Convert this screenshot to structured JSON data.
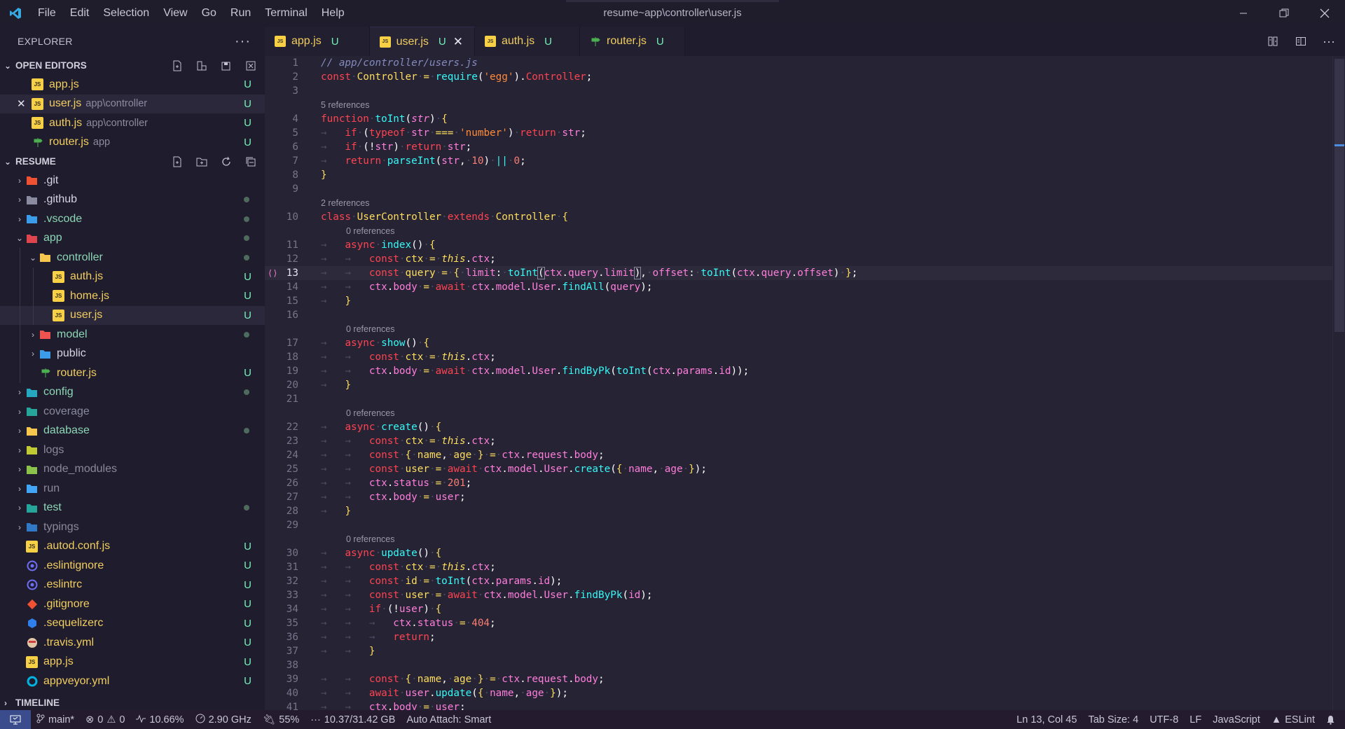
{
  "window": {
    "title": "resume~app\\controller\\user.js",
    "menu": [
      "File",
      "Edit",
      "Selection",
      "View",
      "Go",
      "Run",
      "Terminal",
      "Help"
    ]
  },
  "explorer": {
    "title": "EXPLORER",
    "open_editors_title": "OPEN EDITORS",
    "open_editors": [
      {
        "name": "app.js",
        "desc": "",
        "status": "U",
        "icon": "js",
        "active": false
      },
      {
        "name": "user.js",
        "desc": "app\\controller",
        "status": "U",
        "icon": "js",
        "active": true
      },
      {
        "name": "auth.js",
        "desc": "app\\controller",
        "status": "U",
        "icon": "js",
        "active": false
      },
      {
        "name": "router.js",
        "desc": "app",
        "status": "U",
        "icon": "router",
        "active": false
      }
    ],
    "project_title": "RESUME",
    "tree": [
      {
        "name": ".git",
        "depth": 0,
        "twisty": "›",
        "icon": "git-folder",
        "status": "",
        "color": "plain"
      },
      {
        "name": ".github",
        "depth": 0,
        "twisty": "›",
        "icon": "github-folder",
        "status": "dot",
        "color": "plain"
      },
      {
        "name": ".vscode",
        "depth": 0,
        "twisty": "›",
        "icon": "vscode-folder",
        "status": "dot",
        "color": "mod"
      },
      {
        "name": "app",
        "depth": 0,
        "twisty": "⌄",
        "icon": "app-folder",
        "status": "dot",
        "color": "mod"
      },
      {
        "name": "controller",
        "depth": 1,
        "twisty": "⌄",
        "icon": "controller-folder",
        "status": "dot",
        "color": "mod"
      },
      {
        "name": "auth.js",
        "depth": 2,
        "twisty": "",
        "icon": "js",
        "status": "U",
        "color": "untracked"
      },
      {
        "name": "home.js",
        "depth": 2,
        "twisty": "",
        "icon": "js",
        "status": "U",
        "color": "untracked"
      },
      {
        "name": "user.js",
        "depth": 2,
        "twisty": "",
        "icon": "js",
        "status": "U",
        "color": "untracked",
        "active": true
      },
      {
        "name": "model",
        "depth": 1,
        "twisty": "›",
        "icon": "model-folder",
        "status": "dot",
        "color": "mod"
      },
      {
        "name": "public",
        "depth": 1,
        "twisty": "›",
        "icon": "public-folder",
        "status": "",
        "color": "plain"
      },
      {
        "name": "router.js",
        "depth": 1,
        "twisty": "",
        "icon": "router",
        "status": "U",
        "color": "untracked"
      },
      {
        "name": "config",
        "depth": 0,
        "twisty": "›",
        "icon": "config-folder",
        "status": "dot",
        "color": "mod"
      },
      {
        "name": "coverage",
        "depth": 0,
        "twisty": "›",
        "icon": "coverage-folder",
        "status": "",
        "color": "dim"
      },
      {
        "name": "database",
        "depth": 0,
        "twisty": "›",
        "icon": "database-folder",
        "status": "dot",
        "color": "mod"
      },
      {
        "name": "logs",
        "depth": 0,
        "twisty": "›",
        "icon": "logs-folder",
        "status": "",
        "color": "dim"
      },
      {
        "name": "node_modules",
        "depth": 0,
        "twisty": "›",
        "icon": "node-folder",
        "status": "",
        "color": "dim"
      },
      {
        "name": "run",
        "depth": 0,
        "twisty": "›",
        "icon": "run-folder",
        "status": "",
        "color": "dim"
      },
      {
        "name": "test",
        "depth": 0,
        "twisty": "›",
        "icon": "test-folder",
        "status": "dot",
        "color": "mod"
      },
      {
        "name": "typings",
        "depth": 0,
        "twisty": "›",
        "icon": "typings-folder",
        "status": "",
        "color": "dim"
      },
      {
        "name": ".autod.conf.js",
        "depth": 0,
        "twisty": "",
        "icon": "js",
        "status": "U",
        "color": "untracked"
      },
      {
        "name": ".eslintignore",
        "depth": 0,
        "twisty": "",
        "icon": "eslint",
        "status": "U",
        "color": "untracked"
      },
      {
        "name": ".eslintrc",
        "depth": 0,
        "twisty": "",
        "icon": "eslint",
        "status": "U",
        "color": "untracked"
      },
      {
        "name": ".gitignore",
        "depth": 0,
        "twisty": "",
        "icon": "gitfile",
        "status": "U",
        "color": "untracked"
      },
      {
        "name": ".sequelizerc",
        "depth": 0,
        "twisty": "",
        "icon": "sequelize",
        "status": "U",
        "color": "untracked"
      },
      {
        "name": ".travis.yml",
        "depth": 0,
        "twisty": "",
        "icon": "travis",
        "status": "U",
        "color": "untracked"
      },
      {
        "name": "app.js",
        "depth": 0,
        "twisty": "",
        "icon": "js",
        "status": "U",
        "color": "untracked"
      },
      {
        "name": "appveyor.yml",
        "depth": 0,
        "twisty": "",
        "icon": "appveyor",
        "status": "U",
        "color": "untracked"
      }
    ],
    "timeline_title": "TIMELINE"
  },
  "tabs": [
    {
      "label": "app.js",
      "status": "U",
      "icon": "js",
      "active": false
    },
    {
      "label": "user.js",
      "status": "U",
      "icon": "js",
      "active": true
    },
    {
      "label": "auth.js",
      "status": "U",
      "icon": "js",
      "active": false
    },
    {
      "label": "router.js",
      "status": "U",
      "icon": "router",
      "active": false
    }
  ],
  "editor": {
    "current_line": 13,
    "lines": [
      {
        "n": "1",
        "html": "<span class='cm'>// app/controller/users.js</span>"
      },
      {
        "n": "2",
        "html": "<span class='kw'>const</span><span class='ws'>·</span><span class='k'>Controller</span><span class='ws'>·</span><span class='op'>=</span><span class='ws'>·</span><span class='fn'>require</span><span class='pl'>(</span><span class='st'>'egg'</span><span class='pl'>).</span><span class='kw'>Controller</span><span class='pl'>;</span>"
      },
      {
        "n": "3",
        "html": ""
      },
      {
        "lens": "5 references",
        "indent": 0
      },
      {
        "n": "4",
        "html": "<span class='kw'>function</span><span class='ws'>·</span><span class='fn'>toInt</span><span class='pl'>(</span><span class='va' style='font-style:italic'>str</span><span class='pl'>)</span><span class='ws'>·</span><span class='op'>{</span>"
      },
      {
        "n": "5",
        "html": "<span class='ws'>→   </span><span class='kw'>if</span><span class='ws'>·</span><span class='pl'>(</span><span class='kw'>typeof</span><span class='ws'>·</span><span class='va'>str</span><span class='ws'>·</span><span class='op'>===</span><span class='ws'>·</span><span class='st'>'number'</span><span class='pl'>)</span><span class='ws'>·</span><span class='kw'>return</span><span class='ws'>·</span><span class='va'>str</span><span class='pl'>;</span>"
      },
      {
        "n": "6",
        "html": "<span class='ws'>→   </span><span class='kw'>if</span><span class='ws'>·</span><span class='pl'>(!</span><span class='va'>str</span><span class='pl'>)</span><span class='ws'>·</span><span class='kw'>return</span><span class='ws'>·</span><span class='va'>str</span><span class='pl'>;</span>"
      },
      {
        "n": "7",
        "html": "<span class='ws'>→   </span><span class='kw'>return</span><span class='ws'>·</span><span class='fn'>parseInt</span><span class='pl'>(</span><span class='va'>str</span><span class='pl'>,</span><span class='ws'>·</span><span class='nm'>10</span><span class='pl'>)</span><span class='ws'>·</span><span class='fn'>||</span><span class='ws'>·</span><span class='nm'>0</span><span class='pl'>;</span>"
      },
      {
        "n": "8",
        "html": "<span class='op'>}</span>"
      },
      {
        "n": "9",
        "html": ""
      },
      {
        "lens": "2 references",
        "indent": 0
      },
      {
        "n": "10",
        "html": "<span class='kw'>class</span><span class='ws'>·</span><span class='k'>UserController</span><span class='ws'>·</span><span class='kw'>extends</span><span class='ws'>·</span><span class='k'>Controller</span><span class='ws'>·</span><span class='op'>{</span>"
      },
      {
        "lens": "0 references",
        "indent": 1
      },
      {
        "n": "11",
        "html": "<span class='ws'>→   </span><span class='kw'>async</span><span class='ws'>·</span><span class='fn'>index</span><span class='pl'>()</span><span class='ws'>·</span><span class='op'>{</span>"
      },
      {
        "n": "12",
        "html": "<span class='ws'>→   →   </span><span class='kw'>const</span><span class='ws'>·</span><span class='k'>ctx</span><span class='ws'>·</span><span class='op'>=</span><span class='ws'>·</span><span class='th'>this</span><span class='pl'>.</span><span class='va'>ctx</span><span class='pl'>;</span>"
      },
      {
        "n": "13",
        "cur": true,
        "html": "<span class='ws'>→   →   </span><span class='kw'>const</span><span class='ws'>·</span><span class='k'>query</span><span class='ws'>·</span><span class='op'>=</span><span class='ws'>·</span><span class='op'>{</span><span class='ws'>·</span><span class='va'>limit</span><span class='pl'>:</span><span class='ws'>·</span><span class='fn'>toInt</span><span class='pl' style='outline:1px solid #8a86a0'>(</span><span class='va'>ctx</span><span class='pl'>.</span><span class='va'>query</span><span class='pl'>.</span><span class='va'>limit</span><span class='pl' style='outline:1px solid #8a86a0'>)</span><span class='pl'>,</span><span class='ws'>·</span><span class='va'>offset</span><span class='pl'>:</span><span class='ws'>·</span><span class='fn'>toInt</span><span class='pl'>(</span><span class='va'>ctx</span><span class='pl'>.</span><span class='va'>query</span><span class='pl'>.</span><span class='va'>offset</span><span class='pl'>)</span><span class='ws'>·</span><span class='op'>}</span><span class='pl'>;</span>"
      },
      {
        "n": "14",
        "html": "<span class='ws'>→   →   </span><span class='va'>ctx</span><span class='pl'>.</span><span class='va'>body</span><span class='ws'>·</span><span class='op'>=</span><span class='ws'>·</span><span class='kw'>await</span><span class='ws'>·</span><span class='va'>ctx</span><span class='pl'>.</span><span class='va'>model</span><span class='pl'>.</span><span class='va'>User</span><span class='pl'>.</span><span class='fn'>findAll</span><span class='pl'>(</span><span class='va'>query</span><span class='pl'>);</span>"
      },
      {
        "n": "15",
        "html": "<span class='ws'>→   </span><span class='op'>}</span>"
      },
      {
        "n": "16",
        "html": ""
      },
      {
        "lens": "0 references",
        "indent": 1
      },
      {
        "n": "17",
        "html": "<span class='ws'>→   </span><span class='kw'>async</span><span class='ws'>·</span><span class='fn'>show</span><span class='pl'>()</span><span class='ws'>·</span><span class='op'>{</span>"
      },
      {
        "n": "18",
        "html": "<span class='ws'>→   →   </span><span class='kw'>const</span><span class='ws'>·</span><span class='k'>ctx</span><span class='ws'>·</span><span class='op'>=</span><span class='ws'>·</span><span class='th'>this</span><span class='pl'>.</span><span class='va'>ctx</span><span class='pl'>;</span>"
      },
      {
        "n": "19",
        "html": "<span class='ws'>→   →   </span><span class='va'>ctx</span><span class='pl'>.</span><span class='va'>body</span><span class='ws'>·</span><span class='op'>=</span><span class='ws'>·</span><span class='kw'>await</span><span class='ws'>·</span><span class='va'>ctx</span><span class='pl'>.</span><span class='va'>model</span><span class='pl'>.</span><span class='va'>User</span><span class='pl'>.</span><span class='fn'>findByPk</span><span class='pl'>(</span><span class='fn'>toInt</span><span class='pl'>(</span><span class='va'>ctx</span><span class='pl'>.</span><span class='va'>params</span><span class='pl'>.</span><span class='va'>id</span><span class='pl'>));</span>"
      },
      {
        "n": "20",
        "html": "<span class='ws'>→   </span><span class='op'>}</span>"
      },
      {
        "n": "21",
        "html": ""
      },
      {
        "lens": "0 references",
        "indent": 1
      },
      {
        "n": "22",
        "html": "<span class='ws'>→   </span><span class='kw'>async</span><span class='ws'>·</span><span class='fn'>create</span><span class='pl'>()</span><span class='ws'>·</span><span class='op'>{</span>"
      },
      {
        "n": "23",
        "html": "<span class='ws'>→   →   </span><span class='kw'>const</span><span class='ws'>·</span><span class='k'>ctx</span><span class='ws'>·</span><span class='op'>=</span><span class='ws'>·</span><span class='th'>this</span><span class='pl'>.</span><span class='va'>ctx</span><span class='pl'>;</span>"
      },
      {
        "n": "24",
        "html": "<span class='ws'>→   →   </span><span class='kw'>const</span><span class='ws'>·</span><span class='op'>{</span><span class='ws'>·</span><span class='k'>name</span><span class='pl'>,</span><span class='ws'>·</span><span class='k'>age</span><span class='ws'>·</span><span class='op'>}</span><span class='ws'>·</span><span class='op'>=</span><span class='ws'>·</span><span class='va'>ctx</span><span class='pl'>.</span><span class='va'>request</span><span class='pl'>.</span><span class='va'>body</span><span class='pl'>;</span>"
      },
      {
        "n": "25",
        "html": "<span class='ws'>→   →   </span><span class='kw'>const</span><span class='ws'>·</span><span class='k'>user</span><span class='ws'>·</span><span class='op'>=</span><span class='ws'>·</span><span class='kw'>await</span><span class='ws'>·</span><span class='va'>ctx</span><span class='pl'>.</span><span class='va'>model</span><span class='pl'>.</span><span class='va'>User</span><span class='pl'>.</span><span class='fn'>create</span><span class='pl'>(</span><span class='op'>{</span><span class='ws'>·</span><span class='va'>name</span><span class='pl'>,</span><span class='ws'>·</span><span class='va'>age</span><span class='ws'>·</span><span class='op'>}</span><span class='pl'>);</span>"
      },
      {
        "n": "26",
        "html": "<span class='ws'>→   →   </span><span class='va'>ctx</span><span class='pl'>.</span><span class='va'>status</span><span class='ws'>·</span><span class='op'>=</span><span class='ws'>·</span><span class='nm'>201</span><span class='pl'>;</span>"
      },
      {
        "n": "27",
        "html": "<span class='ws'>→   →   </span><span class='va'>ctx</span><span class='pl'>.</span><span class='va'>body</span><span class='ws'>·</span><span class='op'>=</span><span class='ws'>·</span><span class='va'>user</span><span class='pl'>;</span>"
      },
      {
        "n": "28",
        "html": "<span class='ws'>→   </span><span class='op'>}</span>"
      },
      {
        "n": "29",
        "html": ""
      },
      {
        "lens": "0 references",
        "indent": 1
      },
      {
        "n": "30",
        "html": "<span class='ws'>→   </span><span class='kw'>async</span><span class='ws'>·</span><span class='fn'>update</span><span class='pl'>()</span><span class='ws'>·</span><span class='op'>{</span>"
      },
      {
        "n": "31",
        "html": "<span class='ws'>→   →   </span><span class='kw'>const</span><span class='ws'>·</span><span class='k'>ctx</span><span class='ws'>·</span><span class='op'>=</span><span class='ws'>·</span><span class='th'>this</span><span class='pl'>.</span><span class='va'>ctx</span><span class='pl'>;</span>"
      },
      {
        "n": "32",
        "html": "<span class='ws'>→   →   </span><span class='kw'>const</span><span class='ws'>·</span><span class='k'>id</span><span class='ws'>·</span><span class='op'>=</span><span class='ws'>·</span><span class='fn'>toInt</span><span class='pl'>(</span><span class='va'>ctx</span><span class='pl'>.</span><span class='va'>params</span><span class='pl'>.</span><span class='va'>id</span><span class='pl'>);</span>"
      },
      {
        "n": "33",
        "html": "<span class='ws'>→   →   </span><span class='kw'>const</span><span class='ws'>·</span><span class='k'>user</span><span class='ws'>·</span><span class='op'>=</span><span class='ws'>·</span><span class='kw'>await</span><span class='ws'>·</span><span class='va'>ctx</span><span class='pl'>.</span><span class='va'>model</span><span class='pl'>.</span><span class='va'>User</span><span class='pl'>.</span><span class='fn'>findByPk</span><span class='pl'>(</span><span class='va'>id</span><span class='pl'>);</span>"
      },
      {
        "n": "34",
        "html": "<span class='ws'>→   →   </span><span class='kw'>if</span><span class='ws'>·</span><span class='pl'>(!</span><span class='va'>user</span><span class='pl'>)</span><span class='ws'>·</span><span class='op'>{</span>"
      },
      {
        "n": "35",
        "html": "<span class='ws'>→   →   →   </span><span class='va'>ctx</span><span class='pl'>.</span><span class='va'>status</span><span class='ws'>·</span><span class='op'>=</span><span class='ws'>·</span><span class='nm'>404</span><span class='pl'>;</span>"
      },
      {
        "n": "36",
        "html": "<span class='ws'>→   →   →   </span><span class='kw'>return</span><span class='pl'>;</span>"
      },
      {
        "n": "37",
        "html": "<span class='ws'>→   →   </span><span class='op'>}</span>"
      },
      {
        "n": "38",
        "html": ""
      },
      {
        "n": "39",
        "html": "<span class='ws'>→   →   </span><span class='kw'>const</span><span class='ws'>·</span><span class='op'>{</span><span class='ws'>·</span><span class='k'>name</span><span class='pl'>,</span><span class='ws'>·</span><span class='k'>age</span><span class='ws'>·</span><span class='op'>}</span><span class='ws'>·</span><span class='op'>=</span><span class='ws'>·</span><span class='va'>ctx</span><span class='pl'>.</span><span class='va'>request</span><span class='pl'>.</span><span class='va'>body</span><span class='pl'>;</span>"
      },
      {
        "n": "40",
        "html": "<span class='ws'>→   →   </span><span class='kw'>await</span><span class='ws'>·</span><span class='va'>user</span><span class='pl'>.</span><span class='fn'>update</span><span class='pl'>(</span><span class='op'>{</span><span class='ws'>·</span><span class='va'>name</span><span class='pl'>,</span><span class='ws'>·</span><span class='va'>age</span><span class='ws'>·</span><span class='op'>}</span><span class='pl'>);</span>"
      },
      {
        "n": "41",
        "html": "<span class='ws'>→   →   </span><span class='va'>ctx</span><span class='pl'>.</span><span class='va'>body</span><span class='ws'>·</span><span class='op'>=</span><span class='ws'>·</span><span class='va'>user</span><span class='pl'>;</span>"
      }
    ]
  },
  "statusbar": {
    "branch": "main*",
    "errors": "0",
    "warnings": "0",
    "cpu": "10.66%",
    "freq": "2.90 GHz",
    "battery": "55%",
    "memory": "10.37/31.42 GB",
    "auto_attach": "Auto Attach: Smart",
    "position": "Ln 13, Col 45",
    "tab_size": "Tab Size: 4",
    "encoding": "UTF-8",
    "eol": "LF",
    "language": "JavaScript",
    "linter": "ESLint"
  },
  "colors": {
    "accent": "#3a4c8c",
    "untracked": "#f2cd5f",
    "status_u": "#72f1b8",
    "editor_bg": "#262335",
    "sidebar_bg": "#1f1d2d"
  }
}
